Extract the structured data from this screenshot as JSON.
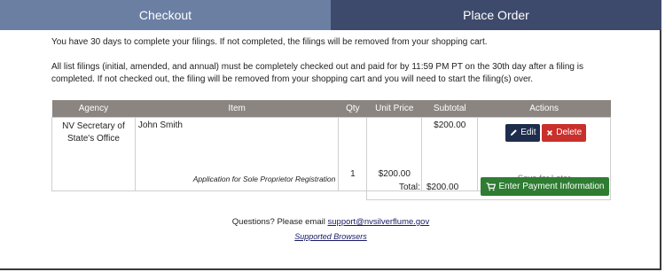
{
  "tabs": {
    "checkout": "Checkout",
    "place_order": "Place Order"
  },
  "messages": {
    "days_notice": "You have 30 days to complete your filings. If not completed, the filings will be removed from your shopping cart.",
    "list_filings_notice": "All list filings (initial, amended, and annual) must be completely checked out and paid for by 11:59 PM PT on the 30th day after a filing is completed. If not checked out, the filing will be removed from your shopping cart and you will need to start the filing(s) over."
  },
  "cart": {
    "headers": [
      "Agency",
      "Item",
      "Qty",
      "Unit Price",
      "Subtotal",
      "Actions"
    ],
    "rows": [
      {
        "agency": "NV Secretary of State's Office",
        "item_name": "John Smith",
        "item_desc": "Application for Sole Proprietor Registration",
        "qty": "1",
        "unit_price": "$200.00",
        "subtotal": "$200.00",
        "edit_label": "Edit",
        "delete_label": "Delete",
        "save_later_label": "Save for Later"
      }
    ],
    "total_label": "Total:",
    "total_value": "$200.00",
    "pay_button_label": "Enter Payment Information"
  },
  "footer": {
    "questions_text": "Questions? Please email ",
    "support_email": "support@nvsilverflume.gov",
    "supported_browsers": "Supported Browsers"
  },
  "colors": {
    "tab_checkout": "#6b7fa3",
    "tab_place_order": "#3e4a6b",
    "table_header": "#8a8580",
    "edit_button": "#1f2d4d",
    "delete_button": "#c9302c",
    "pay_button": "#2e7d32"
  },
  "icons": {
    "edit": "pencil-icon",
    "delete": "x-icon",
    "pay": "cart-icon"
  }
}
